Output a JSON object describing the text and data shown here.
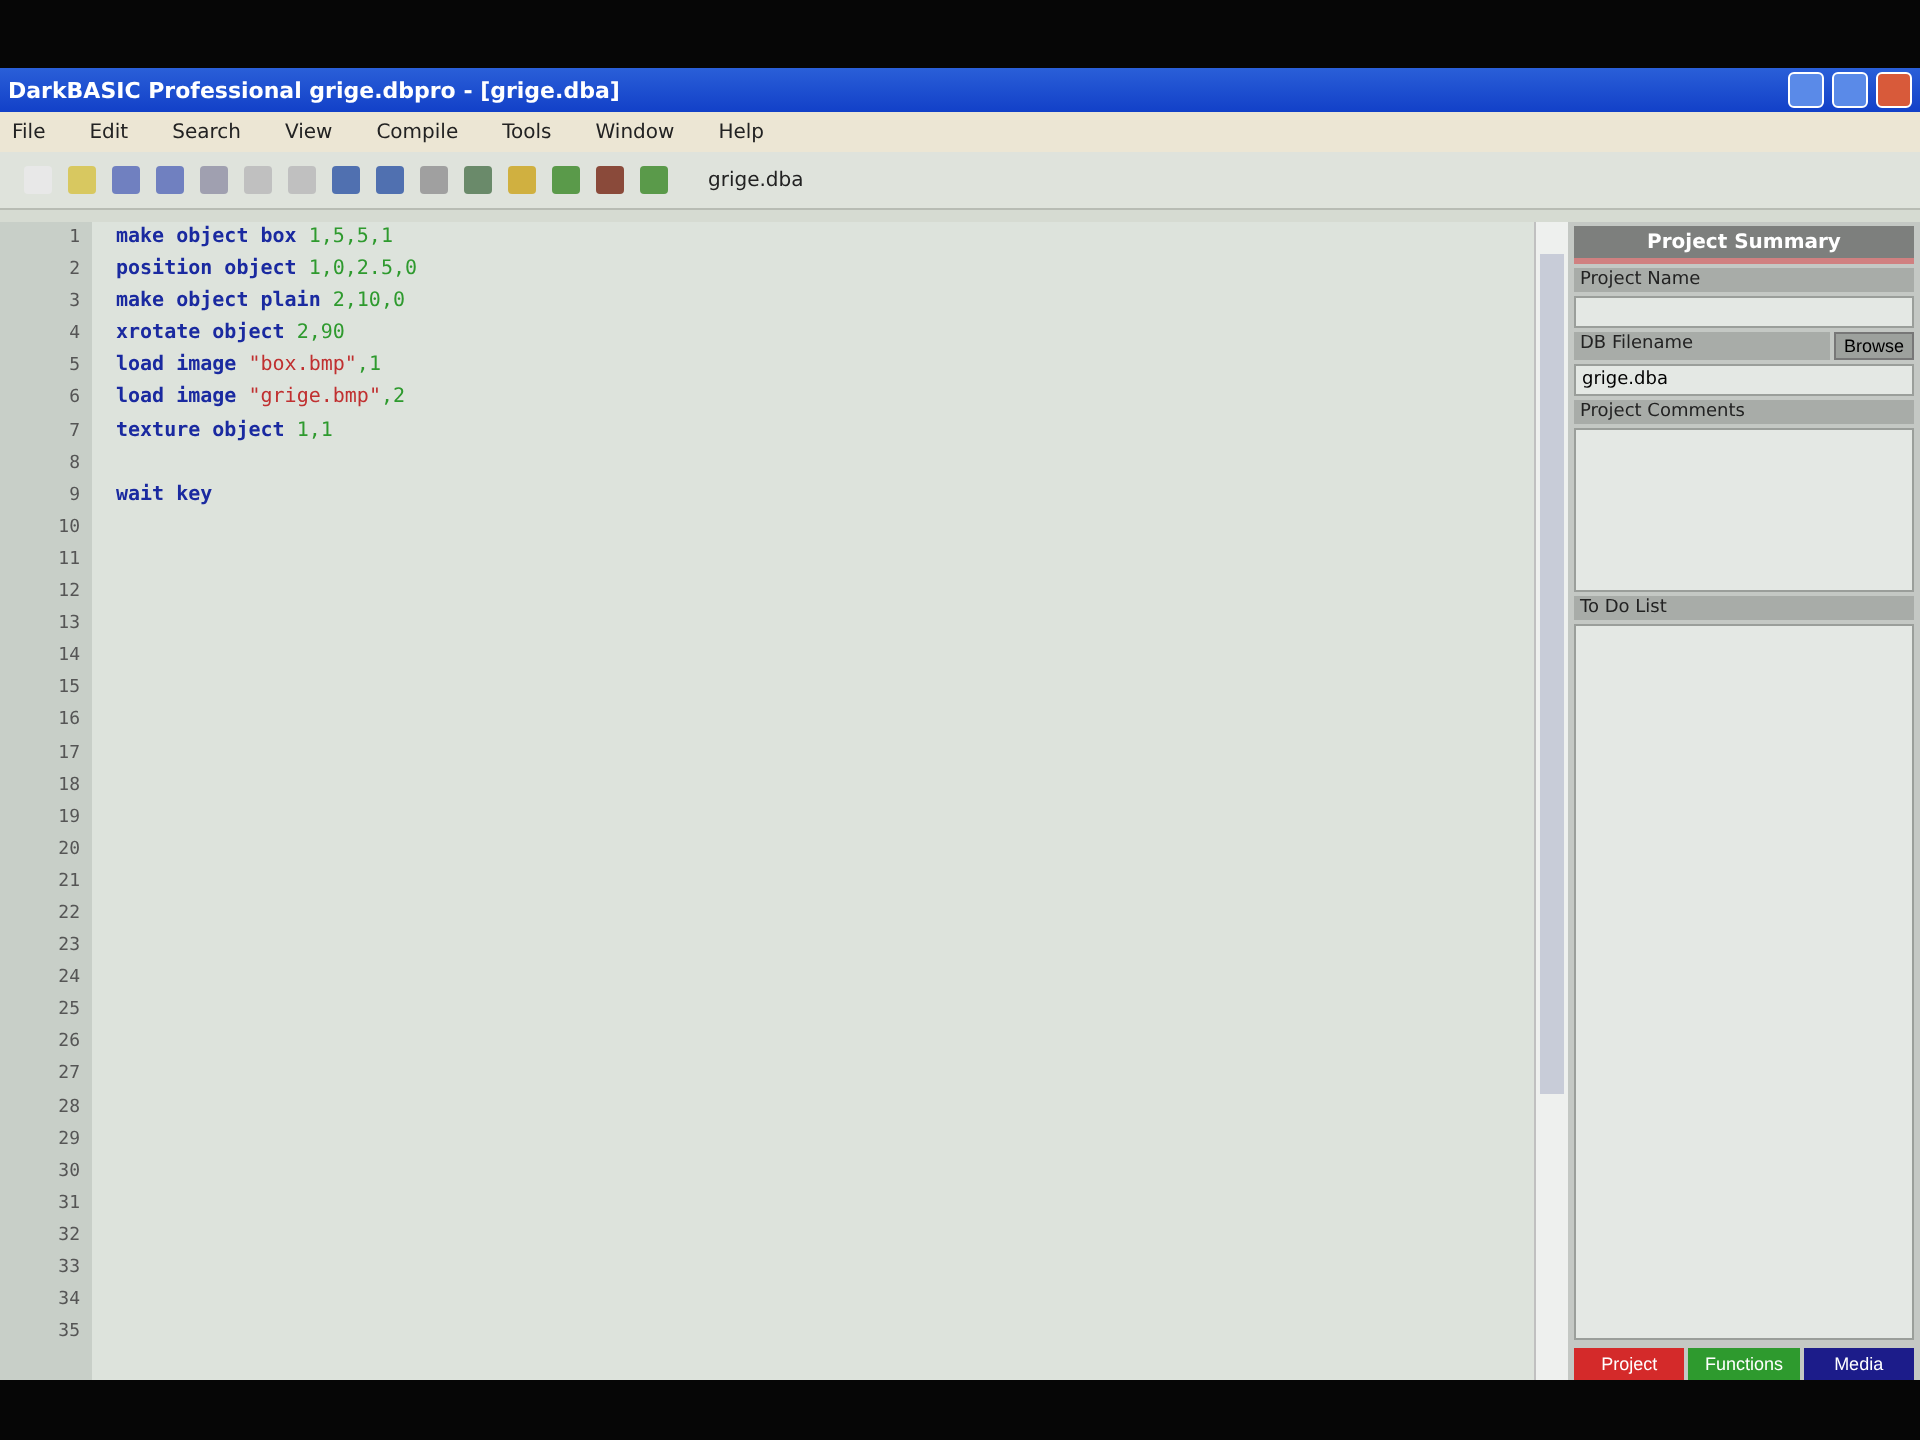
{
  "window": {
    "title": "DarkBASIC Professional grige.dbpro - [grige.dba]"
  },
  "menu": [
    "File",
    "Edit",
    "Search",
    "View",
    "Compile",
    "Tools",
    "Window",
    "Help"
  ],
  "toolbar": {
    "file_dropdown": "grige.dba"
  },
  "editor": {
    "lines": [
      [
        {
          "kind": "keyword",
          "text": "make object box "
        },
        {
          "kind": "number",
          "text": "1,5,5,1"
        }
      ],
      [
        {
          "kind": "keyword",
          "text": "position object "
        },
        {
          "kind": "number",
          "text": "1,0,2.5,0"
        }
      ],
      [
        {
          "kind": "keyword",
          "text": "make object plain "
        },
        {
          "kind": "number",
          "text": "2,10,0"
        }
      ],
      [
        {
          "kind": "keyword",
          "text": "xrotate object "
        },
        {
          "kind": "number",
          "text": "2,90"
        }
      ],
      [
        {
          "kind": "keyword",
          "text": "load image "
        },
        {
          "kind": "string",
          "text": "\"box.bmp\""
        },
        {
          "kind": "number",
          "text": ",1"
        }
      ],
      [
        {
          "kind": "keyword",
          "text": "load image "
        },
        {
          "kind": "string",
          "text": "\"grige.bmp\""
        },
        {
          "kind": "number",
          "text": ",2"
        }
      ],
      [
        {
          "kind": "keyword",
          "text": "texture object "
        },
        {
          "kind": "number",
          "text": "1,1"
        }
      ],
      [
        {
          "kind": "blank"
        }
      ],
      [
        {
          "kind": "keyword",
          "text": "wait key"
        }
      ]
    ],
    "line_numbers": [
      "1",
      "2",
      "3",
      "4",
      "5",
      "6",
      "7",
      "8",
      "9",
      "10",
      "11",
      "12",
      "13",
      "14",
      "15",
      "16",
      "17",
      "18",
      "19",
      "20",
      "21",
      "22",
      "23",
      "24",
      "25",
      "26",
      "27",
      "28",
      "29",
      "30",
      "31",
      "32",
      "33",
      "34",
      "35"
    ]
  },
  "project_panel": {
    "title": "Project Summary",
    "project_name_label": "Project Name",
    "filename_label": "DB Filename",
    "browse_button": "Browse",
    "filename_value": "grige.dba",
    "comments_label": "Project Comments",
    "todo_label": "To Do List",
    "tabs": [
      {
        "label": "Project",
        "color": "#d42a2a"
      },
      {
        "label": "Functions",
        "color": "#2e9a2e"
      },
      {
        "label": "Media",
        "color": "#1c1c8a"
      }
    ]
  }
}
